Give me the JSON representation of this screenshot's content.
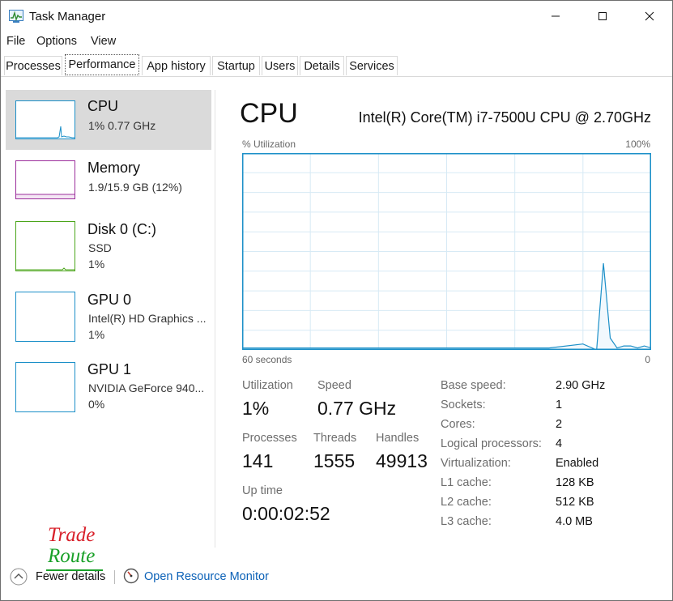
{
  "window": {
    "title": "Task Manager"
  },
  "menu": {
    "file": "File",
    "options": "Options",
    "view": "View"
  },
  "tabs": [
    "Processes",
    "Performance",
    "App history",
    "Startup",
    "Users",
    "Details",
    "Services"
  ],
  "active_tab": "Performance",
  "sidebar": {
    "items": [
      {
        "name": "CPU",
        "line1": "1% 0.77 GHz",
        "line2": "",
        "color": "#1b8fc8",
        "selected": true
      },
      {
        "name": "Memory",
        "line1": "1.9/15.9 GB (12%)",
        "line2": "",
        "color": "#9b2e9b",
        "selected": false
      },
      {
        "name": "Disk 0 (C:)",
        "line1": "SSD",
        "line2": "1%",
        "color": "#4aa519",
        "selected": false
      },
      {
        "name": "GPU 0",
        "line1": "Intel(R) HD Graphics ...",
        "line2": "1%",
        "color": "#1b8fc8",
        "selected": false
      },
      {
        "name": "GPU 1",
        "line1": "NVIDIA GeForce 940...",
        "line2": "0%",
        "color": "#1b8fc8",
        "selected": false
      }
    ]
  },
  "main": {
    "title": "CPU",
    "model": "Intel(R) Core(TM) i7-7500U CPU @ 2.70GHz",
    "util_label": "% Utilization",
    "util_max": "100%",
    "time_label": "60 seconds",
    "time_end": "0",
    "stats": {
      "utilization_label": "Utilization",
      "utilization_value": "1%",
      "speed_label": "Speed",
      "speed_value": "0.77 GHz",
      "processes_label": "Processes",
      "processes_value": "141",
      "threads_label": "Threads",
      "threads_value": "1555",
      "handles_label": "Handles",
      "handles_value": "49913",
      "uptime_label": "Up time",
      "uptime_value": "0:00:02:52"
    },
    "specs": [
      {
        "label": "Base speed:",
        "value": "2.90 GHz"
      },
      {
        "label": "Sockets:",
        "value": "1"
      },
      {
        "label": "Cores:",
        "value": "2"
      },
      {
        "label": "Logical processors:",
        "value": "4"
      },
      {
        "label": "Virtualization:",
        "value": "Enabled"
      },
      {
        "label": "L1 cache:",
        "value": "128 KB"
      },
      {
        "label": "L2 cache:",
        "value": "512 KB"
      },
      {
        "label": "L3 cache:",
        "value": "4.0 MB"
      }
    ]
  },
  "footer": {
    "fewer_details": "Fewer details",
    "open_monitor": "Open Resource Monitor"
  },
  "watermark": {
    "line1": "Trade",
    "line2": "Route"
  },
  "colors": {
    "accent": "#1b8fc8",
    "graph_border": "#1b8fc8",
    "graph_grid": "#d7eaf5",
    "link": "#0b61b7"
  },
  "chart_data": {
    "type": "line",
    "ylabel": "% Utilization",
    "ylim": [
      0,
      100
    ],
    "xlim": [
      60,
      0
    ],
    "x_unit": "seconds ago",
    "series": [
      {
        "x": [
          60,
          45,
          30,
          15,
          10,
          8,
          7,
          6,
          5,
          4,
          3,
          2,
          1,
          0
        ],
        "values": [
          1,
          1,
          1,
          1,
          3,
          0,
          44,
          6,
          1,
          2,
          2,
          1,
          2,
          1
        ]
      }
    ]
  }
}
